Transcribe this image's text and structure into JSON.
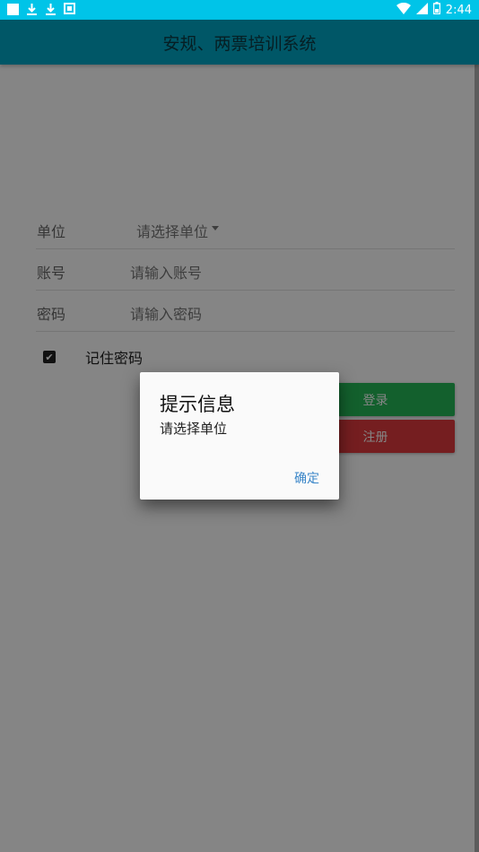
{
  "status_bar": {
    "time": "2:44",
    "icons": [
      "notification-square-icon",
      "download-icon",
      "download-icon",
      "image-icon",
      "wifi-icon",
      "signal-icon",
      "battery-icon"
    ],
    "color": "#00c4e8"
  },
  "app_bar": {
    "title": "安规、两票培训系统",
    "color": "#00a8c6"
  },
  "form": {
    "unit_label": "单位",
    "unit_value": "请选择单位",
    "account_label": "账号",
    "account_placeholder": "请输入账号",
    "password_label": "密码",
    "password_placeholder": "请输入密码",
    "remember_label": "记住密码",
    "remember_checked": true,
    "login_label": "登录",
    "register_label": "注册",
    "login_color": "#26b857",
    "register_color": "#e03a3e"
  },
  "dialog": {
    "title": "提示信息",
    "message": "请选择单位",
    "confirm_label": "确定",
    "confirm_color": "#3a86c8"
  }
}
